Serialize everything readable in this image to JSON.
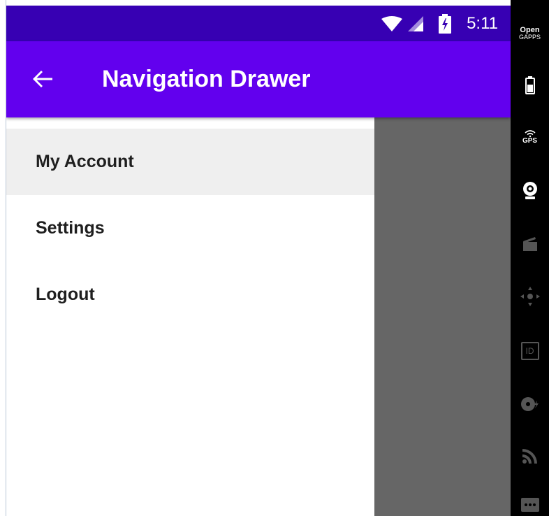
{
  "status_bar": {
    "time": "5:11",
    "icons": [
      "wifi-icon",
      "signal-icon",
      "battery-charging-icon"
    ]
  },
  "app_bar": {
    "title": "Navigation Drawer",
    "back_icon": "arrow-back-icon"
  },
  "drawer": {
    "items": [
      {
        "label": "My Account",
        "active": true
      },
      {
        "label": "Settings",
        "active": false
      },
      {
        "label": "Logout",
        "active": false
      }
    ]
  },
  "side_toolbar": {
    "open_gapps_line1": "Open",
    "open_gapps_line2": "GAPPS",
    "gps_label": "GPS",
    "id_label": "ID",
    "tools": [
      "open-gapps-icon",
      "battery-icon",
      "gps-icon",
      "camera-icon",
      "clapperboard-icon",
      "dpad-icon",
      "id-icon",
      "disk-icon",
      "rss-icon",
      "more-icon"
    ]
  },
  "colors": {
    "status_bar": "#3700b3",
    "app_bar": "#6200ee",
    "scrim": "#666666",
    "active_item": "#efefef",
    "toolbar": "#000000"
  }
}
